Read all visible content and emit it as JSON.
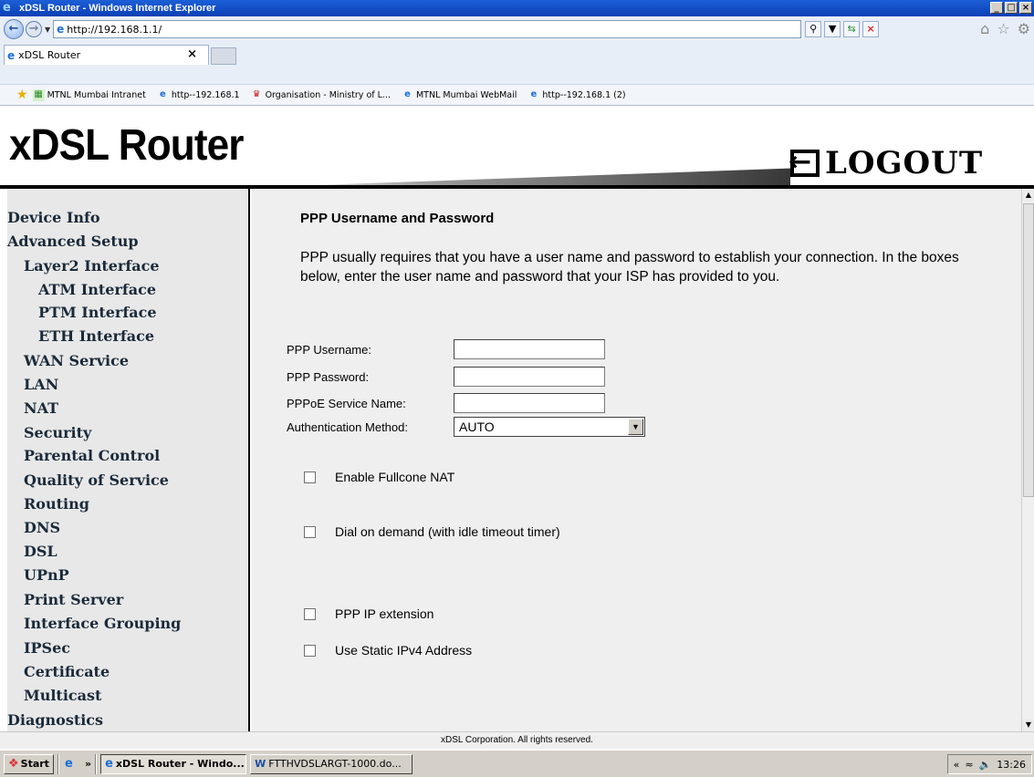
{
  "window": {
    "title": "xDSL Router - Windows Internet Explorer"
  },
  "browser": {
    "url": "http://192.168.1.1/",
    "tab_label": "xDSL Router",
    "favorites": [
      {
        "label": "MTNL Mumbai Intranet",
        "icon": "mtnl-site-icon"
      },
      {
        "label": "http--192.168.1",
        "icon": "ie-page-icon"
      },
      {
        "label": "Organisation - Ministry of L...",
        "icon": "emblem-icon"
      },
      {
        "label": "MTNL Mumbai WebMail",
        "icon": "ie-page-icon"
      },
      {
        "label": "http--192.168.1 (2)",
        "icon": "ie-page-icon"
      }
    ]
  },
  "header": {
    "brand": "xDSL Router",
    "logout": "LOGOUT"
  },
  "sidebar": {
    "items": [
      {
        "label": "Device Info",
        "level": 0
      },
      {
        "label": "Advanced Setup",
        "level": 0
      },
      {
        "label": "Layer2 Interface",
        "level": 1
      },
      {
        "label": "ATM Interface",
        "level": 2
      },
      {
        "label": "PTM Interface",
        "level": 2
      },
      {
        "label": "ETH Interface",
        "level": 2
      },
      {
        "label": "WAN Service",
        "level": 1
      },
      {
        "label": "LAN",
        "level": 1
      },
      {
        "label": "NAT",
        "level": 1
      },
      {
        "label": "Security",
        "level": 1
      },
      {
        "label": "Parental Control",
        "level": 1
      },
      {
        "label": "Quality of Service",
        "level": 1
      },
      {
        "label": "Routing",
        "level": 1
      },
      {
        "label": "DNS",
        "level": 1
      },
      {
        "label": "DSL",
        "level": 1
      },
      {
        "label": "UPnP",
        "level": 1
      },
      {
        "label": "Print Server",
        "level": 1
      },
      {
        "label": "Interface Grouping",
        "level": 1
      },
      {
        "label": "IPSec",
        "level": 1
      },
      {
        "label": "Certificate",
        "level": 1
      },
      {
        "label": "Multicast",
        "level": 1
      },
      {
        "label": "Diagnostics",
        "level": 0
      }
    ]
  },
  "main": {
    "heading": "PPP Username and Password",
    "description": "PPP usually requires that you have a user name and password to establish your connection. In the boxes below, enter the user name and password that your ISP has provided to you.",
    "fields": {
      "username_label": "PPP Username:",
      "username_value": "",
      "password_label": "PPP Password:",
      "password_value": "",
      "service_label": "PPPoE Service Name:",
      "service_value": "",
      "auth_label": "Authentication Method:",
      "auth_value": "AUTO"
    },
    "checkboxes": [
      {
        "label": "Enable Fullcone NAT",
        "checked": false
      },
      {
        "label": "Dial on demand (with idle timeout timer)",
        "checked": false
      },
      {
        "label": "PPP IP extension",
        "checked": false
      },
      {
        "label": "Use Static IPv4 Address",
        "checked": false
      }
    ]
  },
  "footer": {
    "text": "xDSL Corporation. All rights reserved."
  },
  "taskbar": {
    "start": "Start",
    "chevron": "»",
    "buttons": [
      "xDSL Router - Windo...",
      "FTTHVDSLARGT-1000.do..."
    ],
    "tray_chevron": "«",
    "clock": "13:26"
  }
}
